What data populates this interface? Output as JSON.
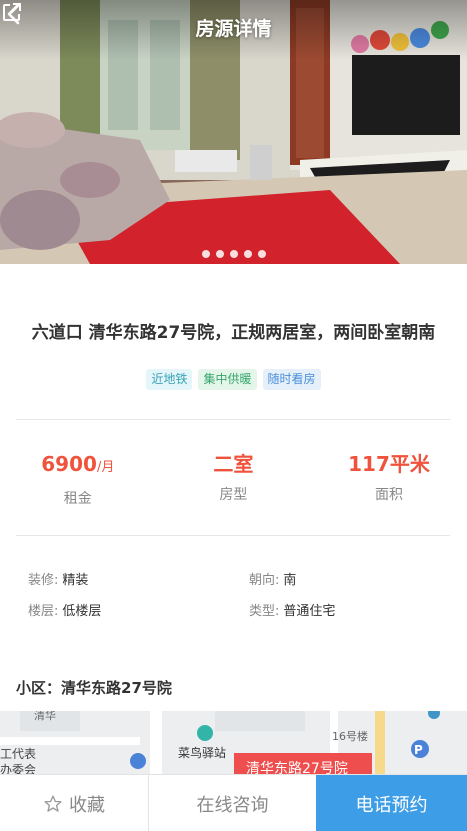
{
  "header": {
    "title": "房源详情",
    "back_icon": "chevron-left-icon",
    "share_icon": "share-icon"
  },
  "gallery": {
    "image_count": 5,
    "watermark": "lianjia"
  },
  "listing": {
    "title": "六道口 清华东路27号院，正规两居室，两间卧室朝南",
    "tags": [
      {
        "label": "近地铁",
        "color": "#3aa3b8"
      },
      {
        "label": "集中供暖",
        "color": "#35a56b"
      },
      {
        "label": "随时看房",
        "color": "#4a8fd9"
      }
    ]
  },
  "stats": {
    "rent_value": "6900",
    "rent_unit": "/月",
    "rent_label": "租金",
    "layout_value": "二室",
    "layout_label": "房型",
    "area_value": "117平米",
    "area_label": "面积"
  },
  "attributes": {
    "decoration_key": "装修:",
    "decoration_value": "精装",
    "orientation_key": "朝向:",
    "orientation_value": "南",
    "floor_key": "楼层:",
    "floor_value": "低楼层",
    "type_key": "类型:",
    "type_value": "普通住宅"
  },
  "community": {
    "label": "小区：清华东路27号院"
  },
  "map": {
    "labels": {
      "station": "菜鸟驿站",
      "building": "16号楼",
      "committee_line1": "工代表",
      "committee_line2": "办委会",
      "top": "清华",
      "pin": "清华东路27号院"
    }
  },
  "actions": {
    "favorite": "收藏",
    "consult": "在线咨询",
    "call": "电话预约"
  },
  "colors": {
    "accent": "#f0533c",
    "primary": "#3d9de6"
  }
}
